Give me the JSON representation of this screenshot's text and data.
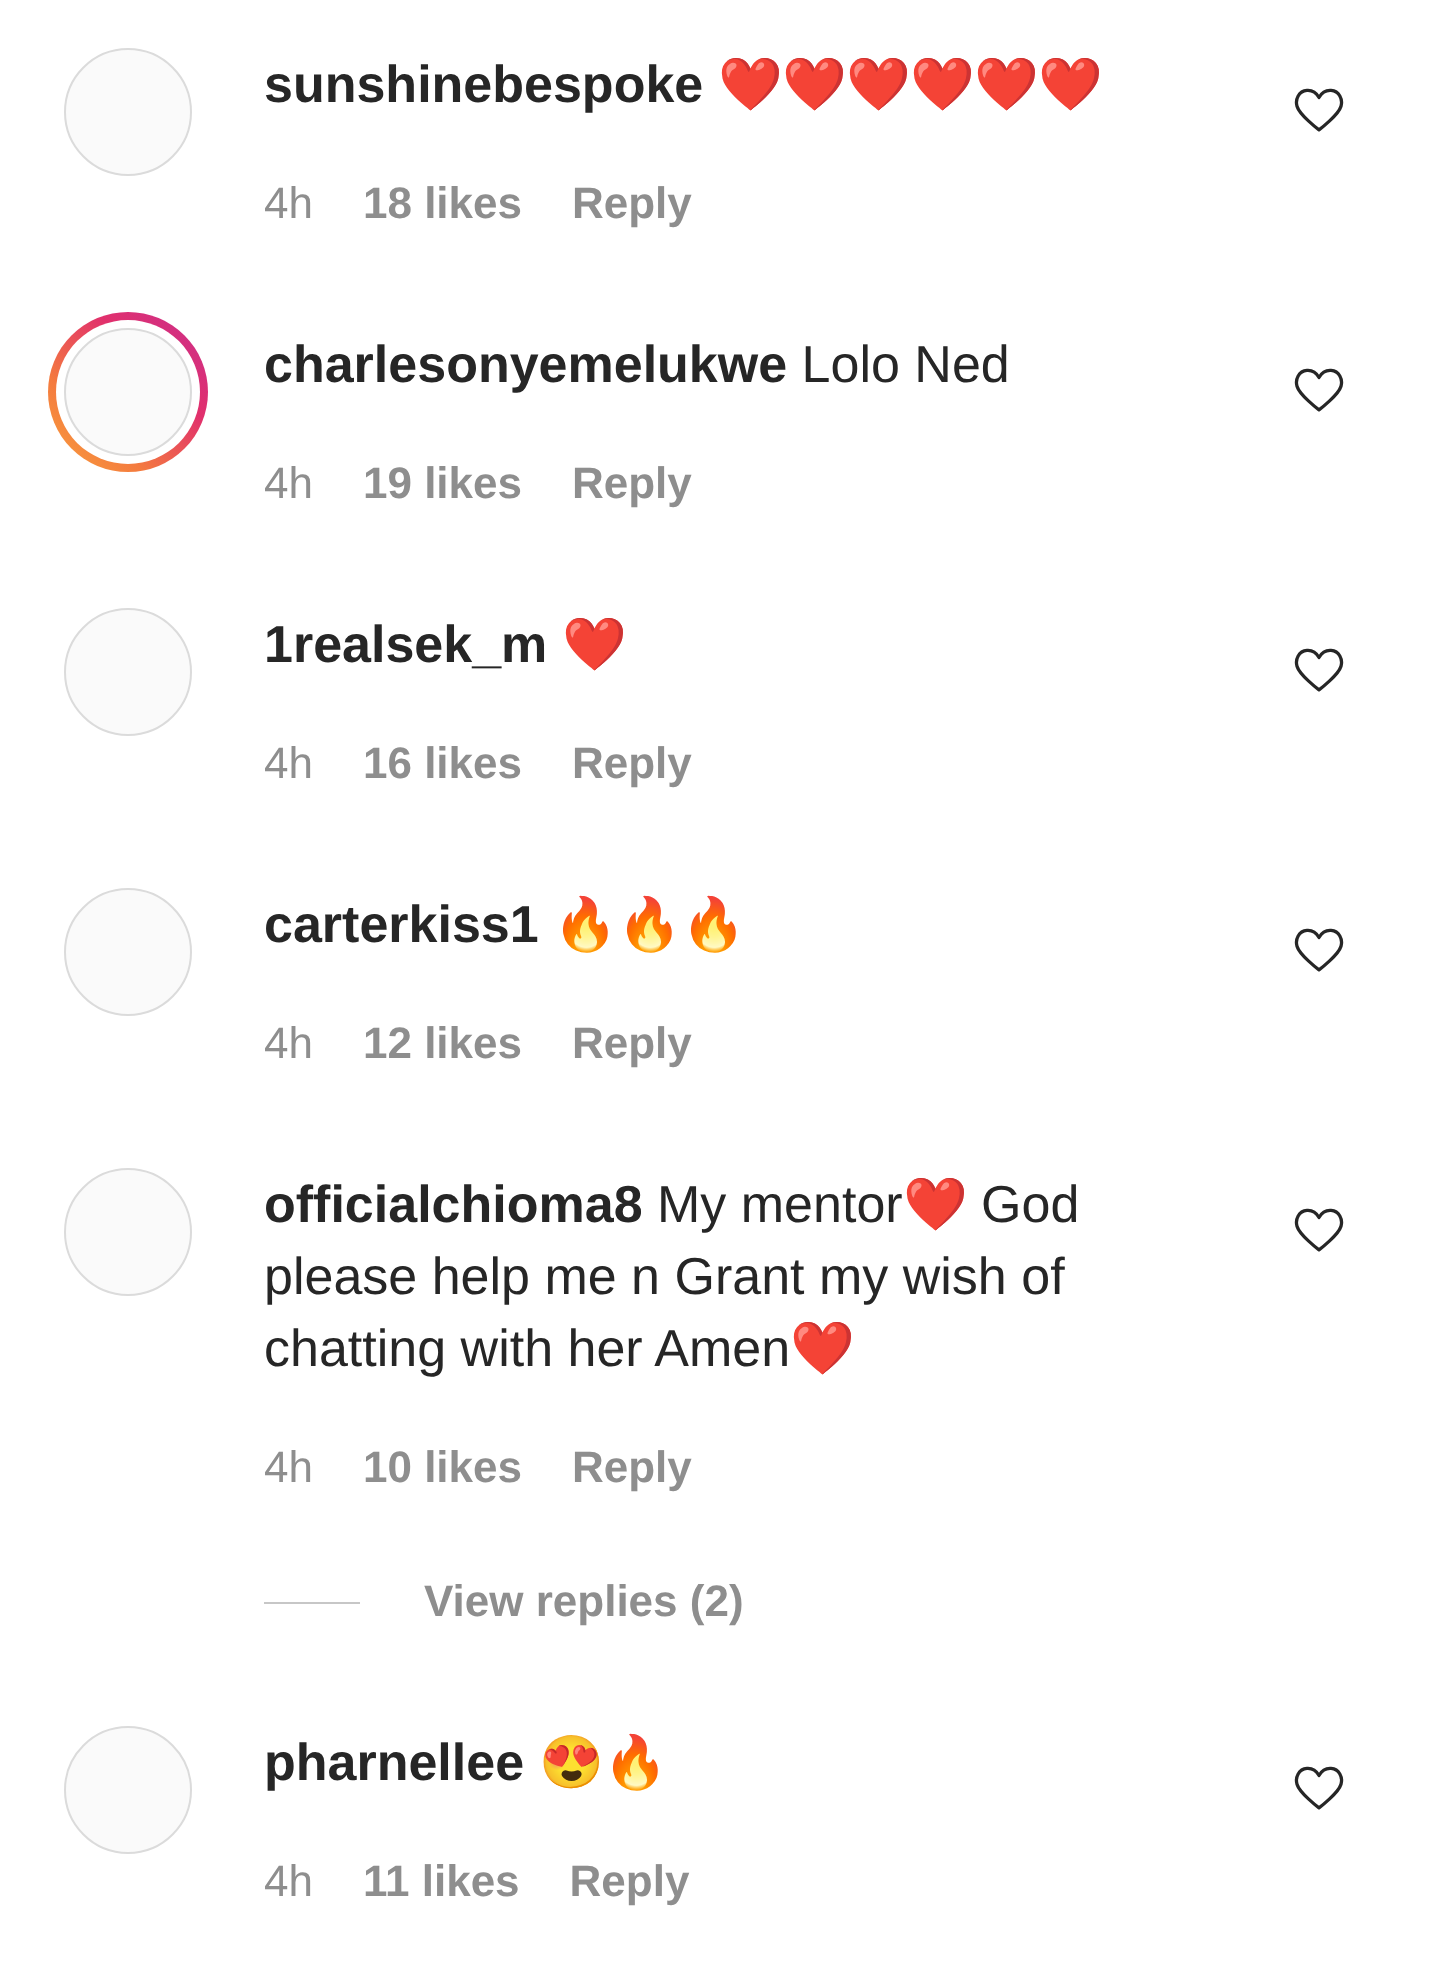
{
  "comments": [
    {
      "username": "sunshinebespoke",
      "text": "❤️❤️❤️❤️❤️❤️",
      "has_story": false,
      "liked": false,
      "time": "4h",
      "likes": "18 likes",
      "reply": "Reply"
    },
    {
      "username": "charlesonyemelukwe",
      "text": "Lolo Ned",
      "has_story": true,
      "liked": false,
      "time": "4h",
      "likes": "19 likes",
      "reply": "Reply"
    },
    {
      "username": "1realsek_m",
      "text": "❤️",
      "has_story": false,
      "liked": false,
      "time": "4h",
      "likes": "16 likes",
      "reply": "Reply"
    },
    {
      "username": "carterkiss1",
      "text": "🔥🔥🔥",
      "has_story": false,
      "liked": false,
      "time": "4h",
      "likes": "12 likes",
      "reply": "Reply"
    },
    {
      "username": "officialchioma8",
      "text": "My mentor❤️ God please help me n Grant my wish of chatting with her Amen❤️",
      "has_story": false,
      "liked": false,
      "time": "4h",
      "likes": "10 likes",
      "reply": "Reply",
      "view_replies": "View replies (2)"
    },
    {
      "username": "pharnellee",
      "text": "😍🔥",
      "has_story": false,
      "liked": false,
      "time": "4h",
      "likes": "11 likes",
      "reply": "Reply"
    }
  ]
}
